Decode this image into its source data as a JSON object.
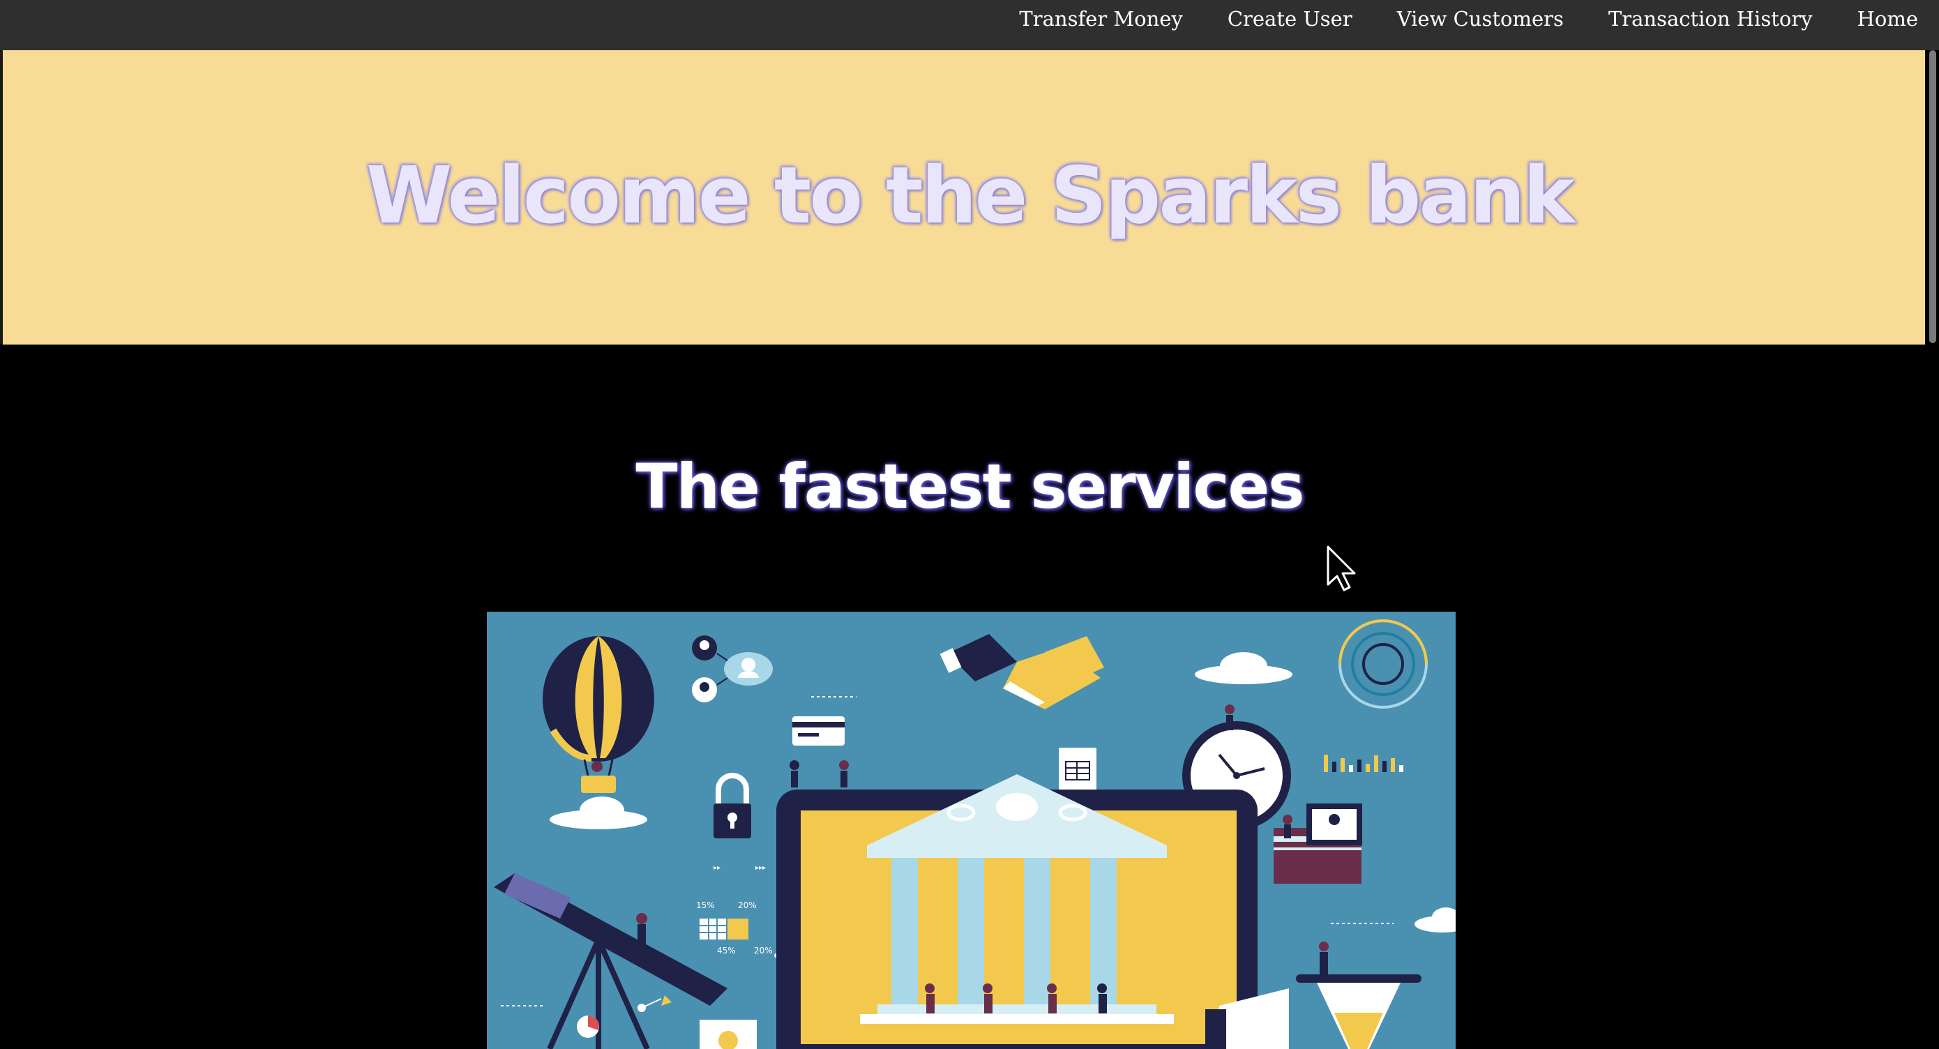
{
  "nav": {
    "items": [
      {
        "label": "Transfer Money"
      },
      {
        "label": "Create User"
      },
      {
        "label": "View Customers"
      },
      {
        "label": "Transaction History"
      },
      {
        "label": "Home"
      }
    ]
  },
  "hero": {
    "title": "Welcome to the Sparks bank"
  },
  "services": {
    "title": "The fastest services"
  },
  "illustration": {
    "percent_labels": [
      "15%",
      "20%",
      "45%",
      "20%"
    ]
  },
  "colors": {
    "navbar_bg": "#2f2f2f",
    "hero_bg": "#f8dc96",
    "page_bg": "#000000",
    "illustration_bg": "#4a90b0",
    "accent_yellow": "#f2c94c",
    "accent_navy": "#1f2147"
  }
}
